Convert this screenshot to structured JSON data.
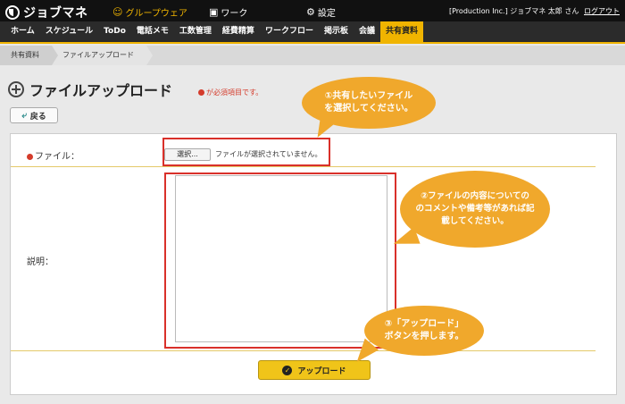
{
  "topbar": {
    "app_name": "ジョブマネ",
    "nav": [
      {
        "label": "グループウェア",
        "icon": "groupware-icon"
      },
      {
        "label": "ワーク",
        "icon": "briefcase-icon"
      },
      {
        "label": "設定",
        "icon": "gear-icon"
      }
    ],
    "user": "[Production Inc.] ジョブマネ 太郎 さん",
    "logout": "ログアウト"
  },
  "menu": {
    "items": [
      "ホーム",
      "スケジュール",
      "ToDo",
      "電話メモ",
      "工数管理",
      "経費精算",
      "ワークフロー",
      "掲示板",
      "会議",
      "共有資料"
    ],
    "active": "共有資料"
  },
  "breadcrumb": [
    "共有資料",
    "ファイルアップロード"
  ],
  "page": {
    "title": "ファイルアップロード",
    "required_note": "が必須項目です。",
    "back_label": "戻る"
  },
  "form": {
    "file_label": "ファイル：",
    "file_button": "選択...",
    "file_status": "ファイルが選択されていません。",
    "description_label": "説明：",
    "upload_button": "アップロード"
  },
  "callouts": [
    {
      "lines": [
        "①共有したいファイル",
        "を選択してください。"
      ]
    },
    {
      "lines": [
        "②ファイルの内容についての",
        "のコメントや備考等があれば記",
        "載してください。"
      ]
    },
    {
      "lines": [
        "③「アップロード」",
        "ボタンを押します。"
      ]
    }
  ],
  "colors": {
    "accent": "#f0b400",
    "callout": "#f0a82c",
    "highlight": "#d9302a",
    "required": "#d43b2b"
  }
}
